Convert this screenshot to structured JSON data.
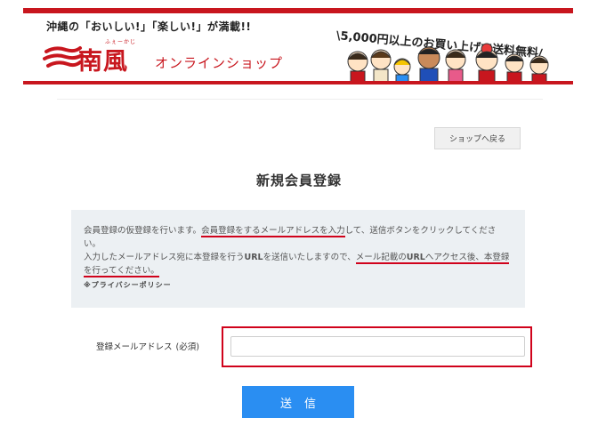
{
  "header": {
    "tagline": "沖縄の「おいしい!」「楽しい!」が満載!!",
    "logo_furigana": "ふぇーかじ",
    "logo_kanji": "南風",
    "logo_subtitle": "オンラインショップ",
    "shipping_banner": "5,000円以上のお買い上げで送料無料",
    "logo_icon": "wave-mark-icon",
    "characters_image": "mascot-characters-illustration"
  },
  "nav": {
    "back_label": "ショップへ戻る"
  },
  "page": {
    "title": "新規会員登録"
  },
  "info": {
    "p1_a": "会員登録の仮登録を行います。",
    "p1_u": "会員登録をするメールアドレスを入力",
    "p1_b": "して、送信ボタンをクリックしてください。",
    "p2_a": "入力したメールアドレス宛に本登録を行う",
    "p2_url1": "URL",
    "p2_b": "を送信いたしますので、",
    "p2_u1": "メール記載の",
    "p2_url2": "URL",
    "p2_u2": "へアクセス後、本登録を行ってください。",
    "privacy": "※プライバシーポリシー"
  },
  "form": {
    "email_label": "登録メールアドレス",
    "email_required": "(必須)",
    "email_value": "",
    "email_placeholder": ""
  },
  "submit": {
    "label": "送信"
  },
  "colors": {
    "brand_red": "#c8161e",
    "annotation_red": "#d0021b",
    "submit_blue": "#2a8ef2",
    "info_bg": "#ecf0f3"
  }
}
